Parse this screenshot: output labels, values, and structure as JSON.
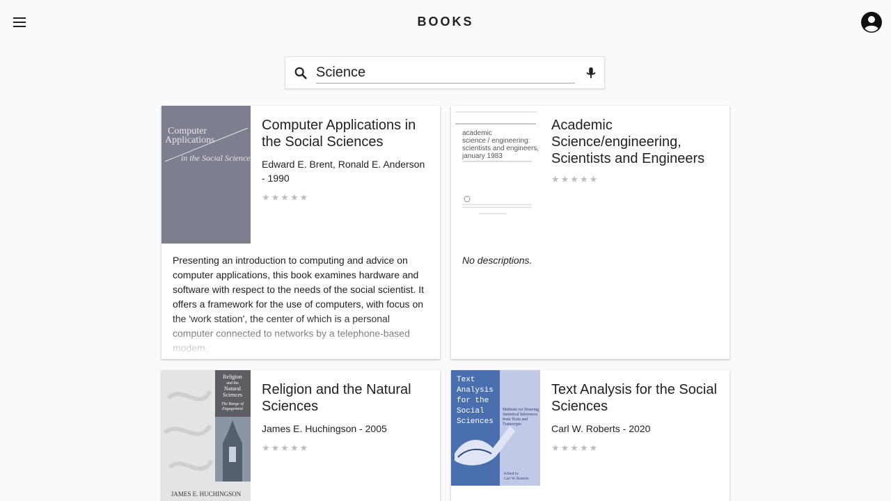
{
  "app": {
    "title": "BOOKS",
    "menu_icon": "menu-icon",
    "account_icon": "account-circle-icon"
  },
  "search": {
    "value": "Science",
    "search_icon": "search-icon",
    "mic_icon": "mic-icon"
  },
  "books": [
    {
      "title": "Computer Applications in the Social Sciences",
      "author": "Edward E. Brent, Ronald E. Anderson - 1990",
      "rating_stars": "★★★★★",
      "description": "Presenting an introduction to computing and advice on computer applications, this book examines hardware and software with respect to the needs of the social scientist. It offers a framework for the use of computers, with focus on the 'work station', the center of which is a personal computer connected to networks by a telephone-based modem.",
      "cover": {
        "line1": "Computer",
        "line2": "Applications",
        "line3": "in the Social Sciences",
        "bg": "#7d7f8e"
      }
    },
    {
      "title": "Academic Science/engineering, Scientists and Engineers",
      "author": "",
      "rating_stars": "★★★★★",
      "description": "No descriptions.",
      "cover": {
        "line1": "academic",
        "line2": "science / engineering:",
        "line3": "scientists and engineers,",
        "line4": "january 1983",
        "bg": "#ffffff"
      }
    },
    {
      "title": "Religion and the Natural Sciences",
      "author": "James E. Huchingson - 2005",
      "rating_stars": "★★★★★",
      "description": "",
      "cover": {
        "line1": "Religion",
        "line2": "and the",
        "line3": "Natural",
        "line4": "Sciences",
        "line5": "The Range of",
        "line6": "Engagement",
        "line7": "JAMES E. HUCHINGSON",
        "bg": "#e4e4e4"
      }
    },
    {
      "title": "Text Analysis for the Social Sciences",
      "author": "Carl W. Roberts - 2020",
      "rating_stars": "★★★★★",
      "description": "",
      "cover": {
        "line1": "Text",
        "line2": "Analysis",
        "line3": "for the",
        "line4": "Social",
        "line5": "Sciences",
        "line6": "Methods for Drawing Statistical Inferences from Texts and Transcripts",
        "line7": "Edited by",
        "line8": "Carl W. Roberts",
        "bg": "#4a6fae"
      }
    }
  ]
}
